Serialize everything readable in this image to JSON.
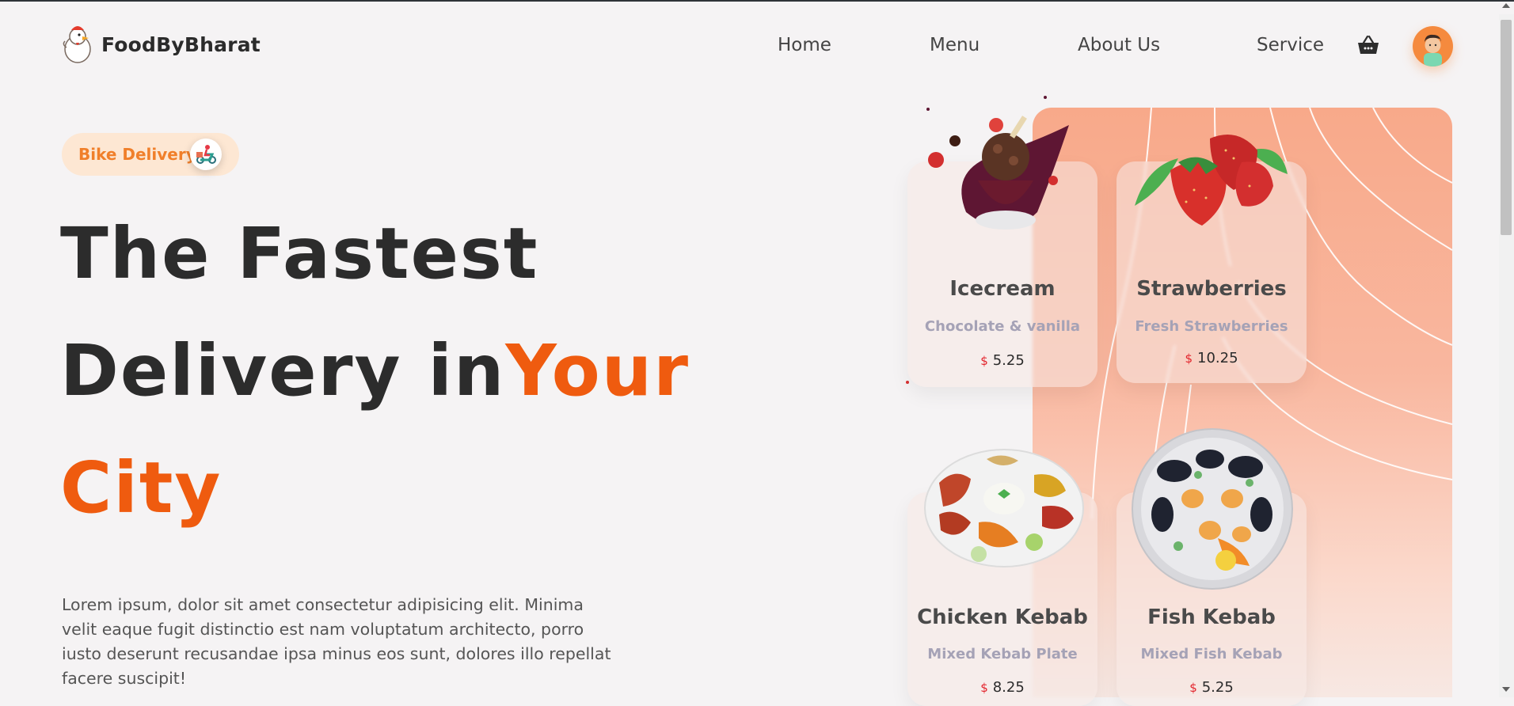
{
  "brand": {
    "name": "FoodByBharat",
    "logo_icon": "chicken-chef-logo"
  },
  "nav": {
    "items": [
      {
        "label": "Home"
      },
      {
        "label": "Menu"
      },
      {
        "label": "About Us"
      },
      {
        "label": "Service"
      }
    ],
    "cart_icon": "basket-icon",
    "avatar_icon": "user-avatar"
  },
  "hero": {
    "badge_label": "Bike Delivery",
    "badge_icon": "scooter-delivery-icon",
    "title_line1": "The Fastest",
    "title_line2_dark": "Delivery in",
    "title_line2_orange": "Your",
    "title_line3": "City",
    "description": "Lorem ipsum, dolor sit amet consectetur adipisicing elit. Minima velit eaque fugit distinctio est nam voluptatum architecto, porro iusto deserunt recusandae ipsa minus eos sunt, dolores illo repellat facere suscipit!"
  },
  "menu_cards": [
    {
      "title": "Icecream",
      "subtitle": "Chocolate & vanilla",
      "currency": "$",
      "price": "5.25",
      "image": "icecream-image"
    },
    {
      "title": "Strawberries",
      "subtitle": "Fresh Strawberries",
      "currency": "$",
      "price": "10.25",
      "image": "strawberries-image"
    },
    {
      "title": "Chicken Kebab",
      "subtitle": "Mixed Kebab Plate",
      "currency": "$",
      "price": "8.25",
      "image": "chicken-kebab-image"
    },
    {
      "title": "Fish Kebab",
      "subtitle": "Mixed Fish Kebab",
      "currency": "$",
      "price": "5.25",
      "image": "fish-kebab-image"
    }
  ],
  "colors": {
    "accent": "#ef5b0f",
    "badge_bg": "#fde7d3",
    "badge_text": "#f07f2a",
    "price_symbol": "#e2232b",
    "panel": "#f8a98a"
  }
}
